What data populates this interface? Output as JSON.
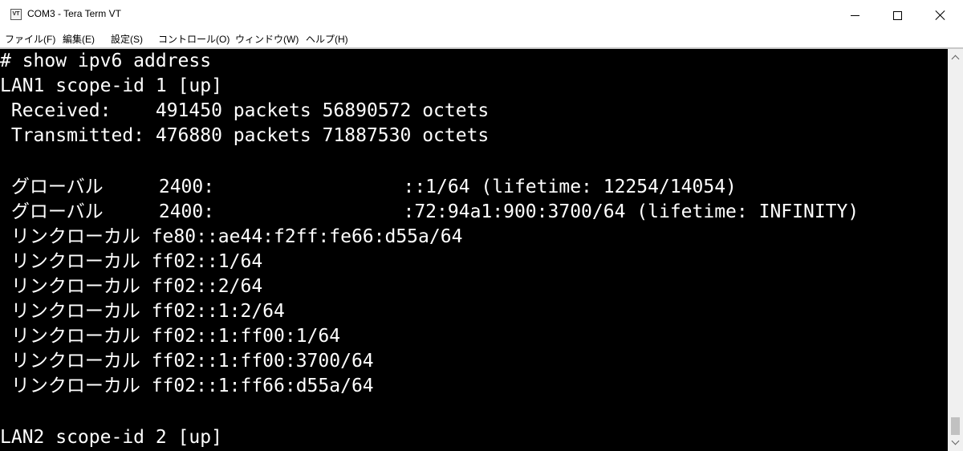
{
  "window": {
    "title": "COM3 - Tera Term VT",
    "icon_text": "VT",
    "icon": "teraterm-app-icon",
    "controls": {
      "minimize_icon": "minimize-icon",
      "maximize_icon": "maximize-icon",
      "close_icon": "close-icon"
    }
  },
  "menu": {
    "items": [
      "ファイル(F)",
      "編集(E)",
      "設定(S)",
      "コントロール(O)",
      "ウィンドウ(W)",
      "ヘルプ(H)"
    ]
  },
  "terminal": {
    "background": "#000000",
    "foreground": "#ffffff",
    "lines": [
      "# show ipv6 address",
      "LAN1 scope-id 1 [up]",
      " Received:    491450 packets 56890572 octets",
      " Transmitted: 476880 packets 71887530 octets",
      "",
      " グローバル     2400:                 ::1/64 (lifetime: 12254/14054)",
      " グローバル     2400:                 :72:94a1:900:3700/64 (lifetime: INFINITY)",
      " リンクローカル fe80::ae44:f2ff:fe66:d55a/64",
      " リンクローカル ff02::1/64",
      " リンクローカル ff02::2/64",
      " リンクローカル ff02::1:2/64",
      " リンクローカル ff02::1:ff00:1/64",
      " リンクローカル ff02::1:ff00:3700/64",
      " リンクローカル ff02::1:ff66:d55a/64",
      "",
      "LAN2 scope-id 2 [up]"
    ]
  },
  "scrollbar": {
    "up_icon": "scroll-up-arrow-icon",
    "down_icon": "scroll-down-arrow-icon"
  }
}
